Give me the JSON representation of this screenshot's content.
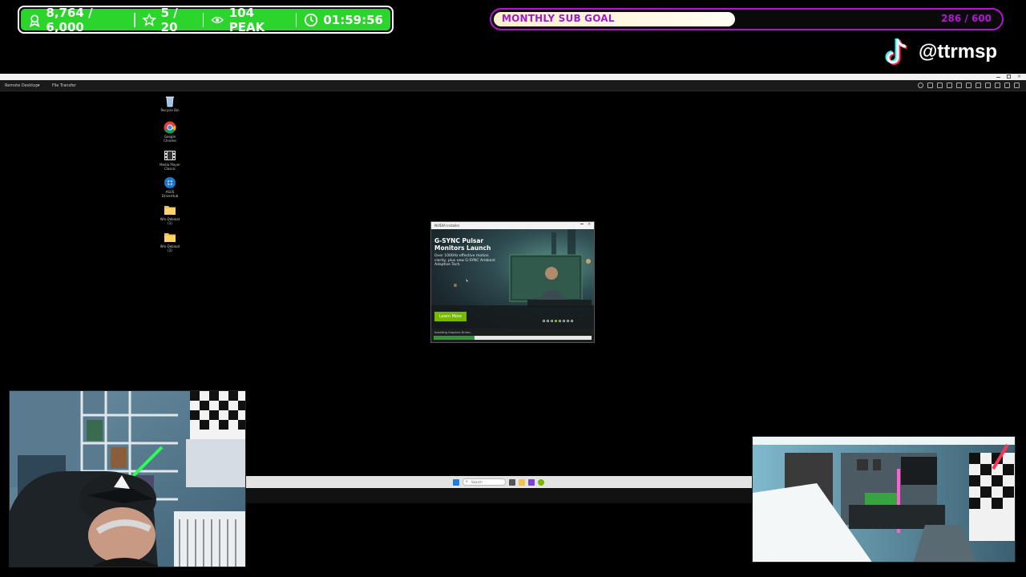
{
  "stats": {
    "followers": "8,764 / 6,000",
    "stars": "5 / 20",
    "peak": "104 PEAK",
    "timer": "01:59:56"
  },
  "sub_goal": {
    "label": "MONTHLY SUB GOAL",
    "count": "286 / 600",
    "progress": 0.477
  },
  "tiktok": {
    "handle": "@ttrmsp"
  },
  "remote_desktop": {
    "menu": [
      "Remote Desktop",
      "File Transfer"
    ]
  },
  "desktop_icons": [
    {
      "label": "Recycle Bin",
      "icon": "recycle-bin-icon"
    },
    {
      "label": "Google Chrome",
      "icon": "chrome-icon"
    },
    {
      "label": "Media Player Classic",
      "icon": "media-player-icon"
    },
    {
      "label": "ASUS DriverHub",
      "icon": "asus-driverhub-icon"
    },
    {
      "label": "Win-Debloat (1)",
      "icon": "folder-icon"
    },
    {
      "label": "Win-Debloat (2)",
      "icon": "folder-icon"
    }
  ],
  "installer": {
    "title": "NVIDIA Installer",
    "heading": "G-SYNC Pulsar Monitors Launch",
    "subtext": "Over 1000Hz effective motion clarity, plus new G-SYNC Ambient Adaptive Tech.",
    "button": "Learn More",
    "progress_label": "Installing Graphics Driver...",
    "progress": 0.26
  },
  "taskbar": {
    "search_placeholder": "Search"
  },
  "colors": {
    "stat_bar": "#2bd52b",
    "sub_goal_border": "#b315d1",
    "nvidia_green": "#76b900"
  }
}
